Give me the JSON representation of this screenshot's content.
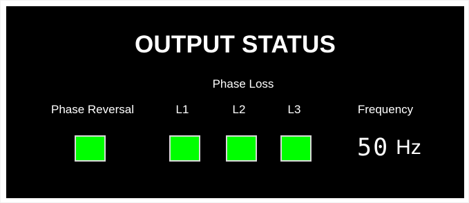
{
  "panel": {
    "title": "OUTPUT STATUS",
    "phase_loss_label": "Phase Loss",
    "columns": {
      "phase_reversal": "Phase Reversal",
      "l1": "L1",
      "l2": "L2",
      "l3": "L3",
      "frequency": "Frequency"
    },
    "indicators": {
      "phase_reversal": {
        "status": "ok",
        "color": "#00ff00"
      },
      "l1": {
        "status": "ok",
        "color": "#00ff00"
      },
      "l2": {
        "status": "ok",
        "color": "#00ff00"
      },
      "l3": {
        "status": "ok",
        "color": "#00ff00"
      }
    },
    "frequency": {
      "value": "50",
      "unit": "Hz"
    },
    "colors": {
      "background": "#000000",
      "text": "#ffffff",
      "indicator_border": "#d9d9d9"
    }
  }
}
